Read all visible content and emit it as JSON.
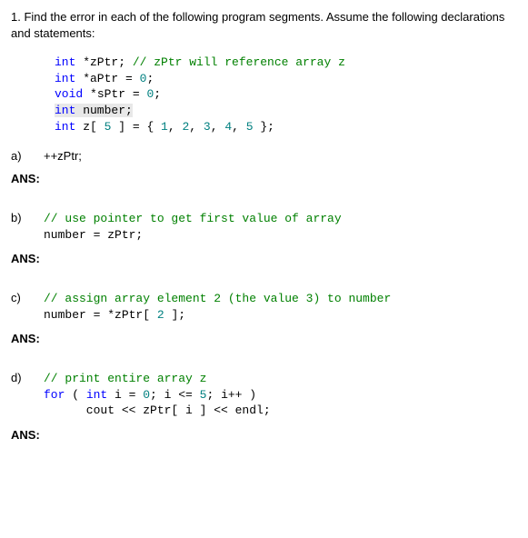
{
  "question": "1. Find the error in each of the following program segments. Assume the following declarations and statements:",
  "decl_line1_a": "int",
  "decl_line1_b": " *zPtr; ",
  "decl_line1_c": "// zPtr will reference array z",
  "decl_line2_a": "int",
  "decl_line2_b": " *aPtr = ",
  "decl_line2_c": "0",
  "decl_line2_d": ";",
  "decl_line3_a": "void",
  "decl_line3_b": " *sPtr = ",
  "decl_line3_c": "0",
  "decl_line3_d": ";",
  "decl_line4_a": "int",
  "decl_line4_b": " number;",
  "decl_line5_a": "int",
  "decl_line5_b": " z[ ",
  "decl_line5_c": "5",
  "decl_line5_d": " ] = { ",
  "decl_line5_e": "1",
  "decl_line5_f": ", ",
  "decl_line5_g": "2",
  "decl_line5_h": ", ",
  "decl_line5_i": "3",
  "decl_line5_j": ", ",
  "decl_line5_k": "4",
  "decl_line5_l": ", ",
  "decl_line5_m": "5",
  "decl_line5_n": " };",
  "part_a": {
    "label": "a)",
    "code": "++zPtr;"
  },
  "part_b": {
    "label": "b)",
    "line1": "// use pointer to get first value of array",
    "line2": "number = zPtr;"
  },
  "part_c": {
    "label": "c)",
    "line1": "// assign array element 2 (the value 3) to number",
    "line2a": "number = *zPtr[ ",
    "line2b": "2",
    "line2c": " ];"
  },
  "part_d": {
    "label": "d)",
    "line1": "// print entire array z",
    "line2a": "for",
    "line2b": " ( ",
    "line2c": "int",
    "line2d": " i = ",
    "line2e": "0",
    "line2f": "; i <= ",
    "line2g": "5",
    "line2h": "; i++ )",
    "line3": "      cout << zPtr[ i ] << endl;"
  },
  "ans_label": "ANS:"
}
